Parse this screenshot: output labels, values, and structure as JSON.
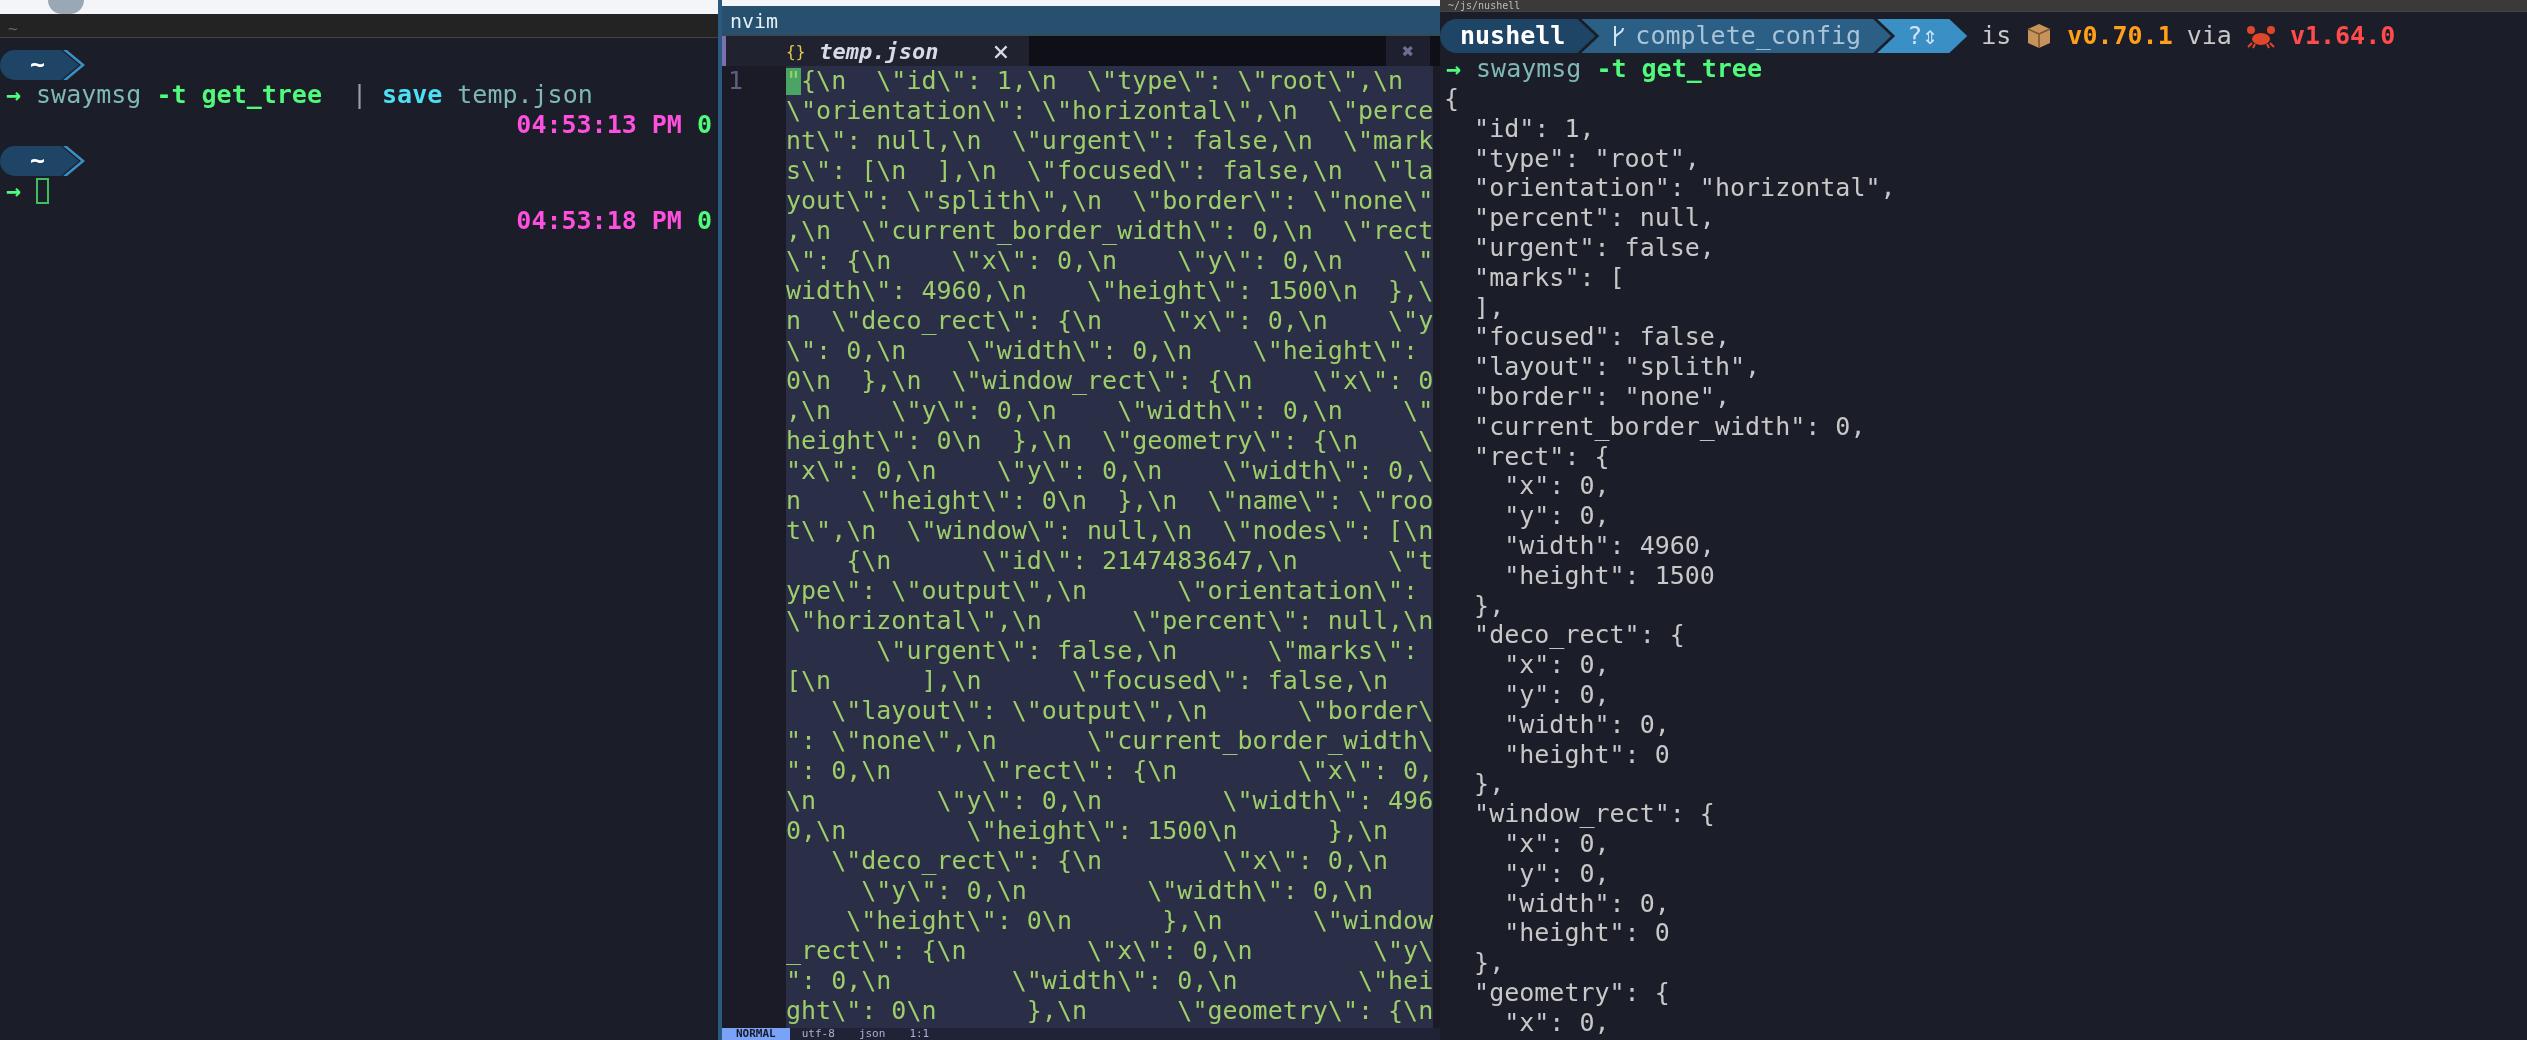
{
  "left_terminal": {
    "title": "~",
    "entries": [
      {
        "prompt_dir": "~",
        "prompt_symbol": "→",
        "command": [
          {
            "kind": "command",
            "text": "swaymsg"
          },
          {
            "kind": "flag",
            "text": "-t"
          },
          {
            "kind": "string",
            "text": "get_tree"
          },
          {
            "kind": "pipe",
            "text": " |"
          },
          {
            "kind": "builtin",
            "text": "save"
          },
          {
            "kind": "path",
            "text": "temp.json"
          }
        ],
        "cursor": false,
        "time": "04:53:13 PM",
        "exit_code": "0"
      },
      {
        "prompt_dir": "~",
        "prompt_symbol": "→",
        "cursor": true,
        "time": "04:53:18 PM",
        "exit_code": "0"
      }
    ]
  },
  "editor": {
    "title": "nvim",
    "tab": {
      "icon": "{}",
      "filename": "temp.json",
      "close": "×"
    },
    "close_all": "✖",
    "line_number": "1",
    "text": "\"{\\n  \\\"id\\\": 1,\\n  \\\"type\\\": \\\"root\\\",\\n  \\\"orientation\\\": \\\"horizontal\\\",\\n  \\\"percent\\\": null,\\n  \\\"urgent\\\": false,\\n  \\\"marks\\\": [\\n  ],\\n  \\\"focused\\\": false,\\n  \\\"layout\\\": \\\"splith\\\",\\n  \\\"border\\\": \\\"none\\\",\\n  \\\"current_border_width\\\": 0,\\n  \\\"rect\\\": {\\n    \\\"x\\\": 0,\\n    \\\"y\\\": 0,\\n    \\\"width\\\": 4960,\\n    \\\"height\\\": 1500\\n  },\\n  \\\"deco_rect\\\": {\\n    \\\"x\\\": 0,\\n    \\\"y\\\": 0,\\n    \\\"width\\\": 0,\\n    \\\"height\\\": 0\\n  },\\n  \\\"window_rect\\\": {\\n    \\\"x\\\": 0,\\n    \\\"y\\\": 0,\\n    \\\"width\\\": 0,\\n    \\\"height\\\": 0\\n  },\\n  \\\"geometry\\\": {\\n    \\\"x\\\": 0,\\n    \\\"y\\\": 0,\\n    \\\"width\\\": 0,\\n    \\\"height\\\": 0\\n  },\\n  \\\"name\\\": \\\"root\\\",\\n  \\\"window\\\": null,\\n  \\\"nodes\\\": [\\n    {\\n      \\\"id\\\": 2147483647,\\n      \\\"type\\\": \\\"output\\\",\\n      \\\"orientation\\\": \\\"horizontal\\\",\\n      \\\"percent\\\": null,\\n      \\\"urgent\\\": false,\\n      \\\"marks\\\": [\\n      ],\\n      \\\"focused\\\": false,\\n      \\\"layout\\\": \\\"output\\\",\\n      \\\"border\\\": \\\"none\\\",\\n      \\\"current_border_width\\\": 0,\\n      \\\"rect\\\": {\\n        \\\"x\\\": 0,\\n        \\\"y\\\": 0,\\n        \\\"width\\\": 4960,\\n        \\\"height\\\": 1500\\n      },\\n      \\\"deco_rect\\\": {\\n        \\\"x\\\": 0,\\n        \\\"y\\\": 0,\\n        \\\"width\\\": 0,\\n        \\\"height\\\": 0\\n      },\\n      \\\"window_rect\\\": {\\n        \\\"x\\\": 0,\\n        \\\"y\\\": 0,\\n        \\\"width\\\": 0,\\n        \\\"height\\\": 0\\n      },\\n      \\\"geometry\\\": {\\n",
    "mode": "NORMAL",
    "status_items": [
      "utf-8",
      "json",
      "1:1"
    ]
  },
  "right_terminal": {
    "title": "~/js/nushell",
    "prompt": {
      "dir": "nushell",
      "branch": "complete_config",
      "git_status": "?⇕",
      "info": [
        {
          "kind": "plain",
          "text": "is"
        },
        {
          "kind": "package"
        },
        {
          "kind": "version",
          "text": "v0.70.1"
        },
        {
          "kind": "plain",
          "text": "via"
        },
        {
          "kind": "crab"
        },
        {
          "kind": "rust",
          "text": "v1.64.0"
        }
      ]
    },
    "prompt_symbol": "→",
    "command": [
      {
        "kind": "command",
        "text": "swaymsg"
      },
      {
        "kind": "flag",
        "text": "-t"
      },
      {
        "kind": "string",
        "text": "get_tree"
      }
    ],
    "output_lines": [
      "{",
      "  \"id\": 1,",
      "  \"type\": \"root\",",
      "  \"orientation\": \"horizontal\",",
      "  \"percent\": null,",
      "  \"urgent\": false,",
      "  \"marks\": [",
      "  ],",
      "  \"focused\": false,",
      "  \"layout\": \"splith\",",
      "  \"border\": \"none\",",
      "  \"current_border_width\": 0,",
      "  \"rect\": {",
      "    \"x\": 0,",
      "    \"y\": 0,",
      "    \"width\": 4960,",
      "    \"height\": 1500",
      "  },",
      "  \"deco_rect\": {",
      "    \"x\": 0,",
      "    \"y\": 0,",
      "    \"width\": 0,",
      "    \"height\": 0",
      "  },",
      "  \"window_rect\": {",
      "    \"x\": 0,",
      "    \"y\": 0,",
      "    \"width\": 0,",
      "    \"height\": 0",
      "  },",
      "  \"geometry\": {",
      "    \"x\": 0,"
    ]
  }
}
